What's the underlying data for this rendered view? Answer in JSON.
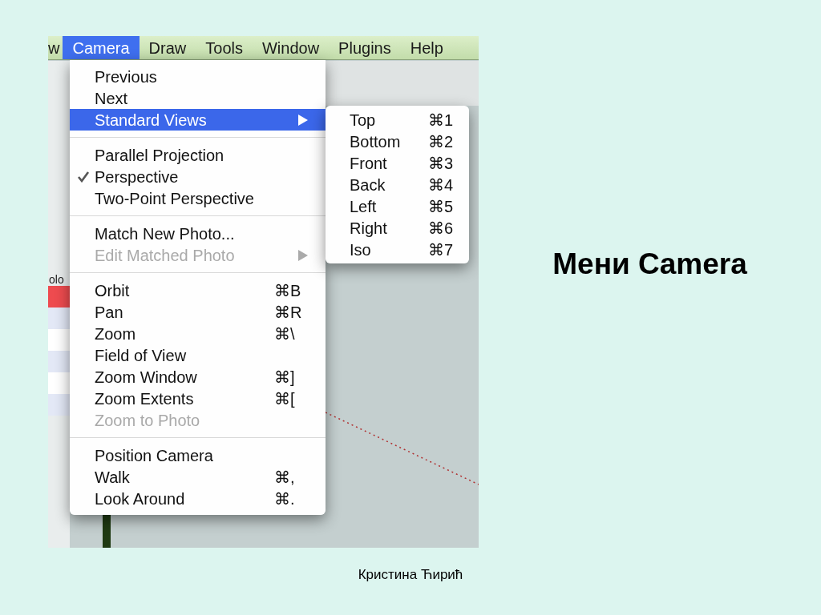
{
  "menu_bar": [
    {
      "label": "w",
      "selected": false
    },
    {
      "label": "Camera",
      "selected": true
    },
    {
      "label": "Draw",
      "selected": false
    },
    {
      "label": "Tools",
      "selected": false
    },
    {
      "label": "Window",
      "selected": false
    },
    {
      "label": "Plugins",
      "selected": false
    },
    {
      "label": "Help",
      "selected": false
    }
  ],
  "side_panel": {
    "label": "olo",
    "rows": [
      {
        "color": "#ee4b4f"
      },
      {
        "color": "#e3e8f6"
      },
      {
        "color": "#ffffff"
      },
      {
        "color": "#e3e8f6"
      },
      {
        "color": "#ffffff"
      },
      {
        "color": "#e3e8f6"
      }
    ]
  },
  "camera_menu": {
    "sections": [
      [
        {
          "label": "Previous",
          "selected": false,
          "checked": false,
          "disabled": false,
          "submenu": false
        },
        {
          "label": "Next",
          "selected": false,
          "checked": false,
          "disabled": false,
          "submenu": false
        },
        {
          "label": "Standard Views",
          "selected": true,
          "checked": false,
          "disabled": false,
          "submenu": true
        }
      ],
      [
        {
          "label": "Parallel Projection",
          "selected": false,
          "checked": false,
          "disabled": false,
          "submenu": false
        },
        {
          "label": "Perspective",
          "selected": false,
          "checked": true,
          "disabled": false,
          "submenu": false
        },
        {
          "label": "Two-Point Perspective",
          "selected": false,
          "checked": false,
          "disabled": false,
          "submenu": false
        }
      ],
      [
        {
          "label": "Match New Photo...",
          "selected": false,
          "checked": false,
          "disabled": false,
          "submenu": false
        },
        {
          "label": "Edit Matched Photo",
          "selected": false,
          "checked": false,
          "disabled": true,
          "submenu": true
        }
      ],
      [
        {
          "label": "Orbit",
          "shortcut": "⌘B",
          "selected": false,
          "checked": false,
          "disabled": false,
          "submenu": false
        },
        {
          "label": "Pan",
          "shortcut": "⌘R",
          "selected": false,
          "checked": false,
          "disabled": false,
          "submenu": false
        },
        {
          "label": "Zoom",
          "shortcut": "⌘\\",
          "selected": false,
          "checked": false,
          "disabled": false,
          "submenu": false
        },
        {
          "label": "Field of View",
          "selected": false,
          "checked": false,
          "disabled": false,
          "submenu": false
        },
        {
          "label": "Zoom Window",
          "shortcut": "⌘]",
          "selected": false,
          "checked": false,
          "disabled": false,
          "submenu": false
        },
        {
          "label": "Zoom Extents",
          "shortcut": "⌘[",
          "selected": false,
          "checked": false,
          "disabled": false,
          "submenu": false
        },
        {
          "label": "Zoom to Photo",
          "selected": false,
          "checked": false,
          "disabled": true,
          "submenu": false
        }
      ],
      [
        {
          "label": "Position Camera",
          "selected": false,
          "checked": false,
          "disabled": false,
          "submenu": false
        },
        {
          "label": "Walk",
          "shortcut": "⌘,",
          "selected": false,
          "checked": false,
          "disabled": false,
          "submenu": false
        },
        {
          "label": "Look Around",
          "shortcut": "⌘.",
          "selected": false,
          "checked": false,
          "disabled": false,
          "submenu": false
        }
      ]
    ]
  },
  "standard_views_menu": [
    {
      "label": "Top",
      "shortcut": "⌘1"
    },
    {
      "label": "Bottom",
      "shortcut": "⌘2"
    },
    {
      "label": "Front",
      "shortcut": "⌘3"
    },
    {
      "label": "Back",
      "shortcut": "⌘4"
    },
    {
      "label": "Left",
      "shortcut": "⌘5"
    },
    {
      "label": "Right",
      "shortcut": "⌘6"
    },
    {
      "label": "Iso",
      "shortcut": "⌘7"
    }
  ],
  "slide": {
    "title": "Мени Camera",
    "author": "Кристина Ћирић"
  }
}
